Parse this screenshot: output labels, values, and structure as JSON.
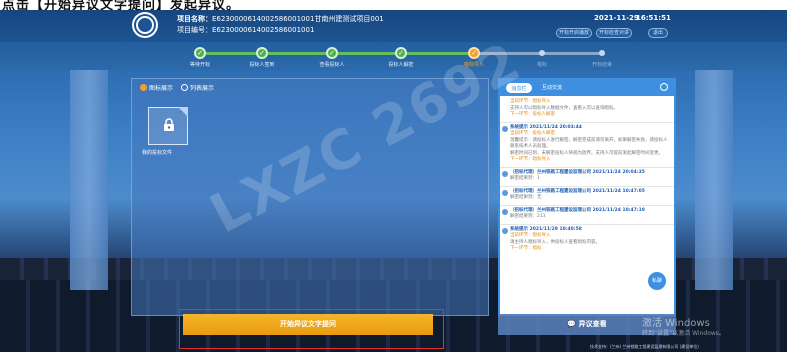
{
  "doc": {
    "caption": "点击【开始异议文字提问】发起异议。"
  },
  "header": {
    "project_name_label": "项目名称：",
    "project_name": "E6230000614002586001001甘南州建测试项目001",
    "project_no_label": "项目编号：",
    "project_no": "E6230000614002586001001",
    "date": "2021-11-29",
    "time": "16:51:51",
    "pills": [
      "开标开启播放",
      "开标检查对讲",
      "退出"
    ]
  },
  "progress": {
    "steps": [
      {
        "label": "等待开标",
        "state": "done"
      },
      {
        "label": "投标人签到",
        "state": "done"
      },
      {
        "label": "查看投标人",
        "state": "done"
      },
      {
        "label": "投标人解密",
        "state": "done"
      },
      {
        "label": "唱标导入",
        "state": "current"
      },
      {
        "label": "唱标",
        "state": "todo"
      },
      {
        "label": "开标结束",
        "state": "todo"
      }
    ],
    "check": "✓"
  },
  "left": {
    "radio_icons": "图标展示",
    "radio_list": "列表展示",
    "folder_name": "我的投标文件"
  },
  "right": {
    "tab_msg": "消息栏",
    "tab_chat": "互动交流",
    "messages": [
      {
        "title": "",
        "lines": [
          "当前环节：唱标导入",
          "支持人可以唱标导入数据文件，查看入可以查询唱标。"
        ],
        "next": "下一环节：投标人解密"
      },
      {
        "title": "系统提示 2021/11/24 20:03:44",
        "lines": [
          "当前环节：投标人解密",
          "温馨提示：请投标人进行解密，解密完成前请勿离开，如果解密失败，请投标人联系技术人员处理。",
          "解密时间已到，未解密投标人将视为放弃。支持人可提前发起解密时间变更。"
        ],
        "next": "下一环节：唱标导入"
      },
      {
        "title": "（招标代理）兰州铁路工程建设监理公司 2021/11/24 20:04:35",
        "lines": [
          "解密结果到：1"
        ],
        "next": ""
      },
      {
        "title": "（招标代理）兰州铁路工程建设监理公司 2021/11/24 10:47:05",
        "lines": [
          "解密结果到：无"
        ],
        "next": ""
      },
      {
        "title": "（招标代理）兰州铁路工程建设监理公司 2021/11/24 10:47:19",
        "lines": [
          "解密结果到：213"
        ],
        "next": ""
      },
      {
        "title": "系统提示 2021/11/29 10:40:58",
        "lines": [
          "当前环节：唱标导入",
          "请主持人唱标导入，供投标人查看唱标内容。"
        ],
        "next": "下一环节：唱标"
      }
    ],
    "chat_button": "私聊"
  },
  "bottom": {
    "start_button": "开始异议文字提问",
    "dispute_button": "💬 异议查看",
    "win_line1": "激活 Windows",
    "win_line2": "转到“设置”以激活 Windows。",
    "footer": "技术支持：(兰州) 兰州铁路工程建设监理有限公司 (建设单位)"
  },
  "watermark": "LXZC 2692",
  "colors": {
    "accent": "#f0a030",
    "primary": "#3f8fe0",
    "done": "#4caf50"
  }
}
